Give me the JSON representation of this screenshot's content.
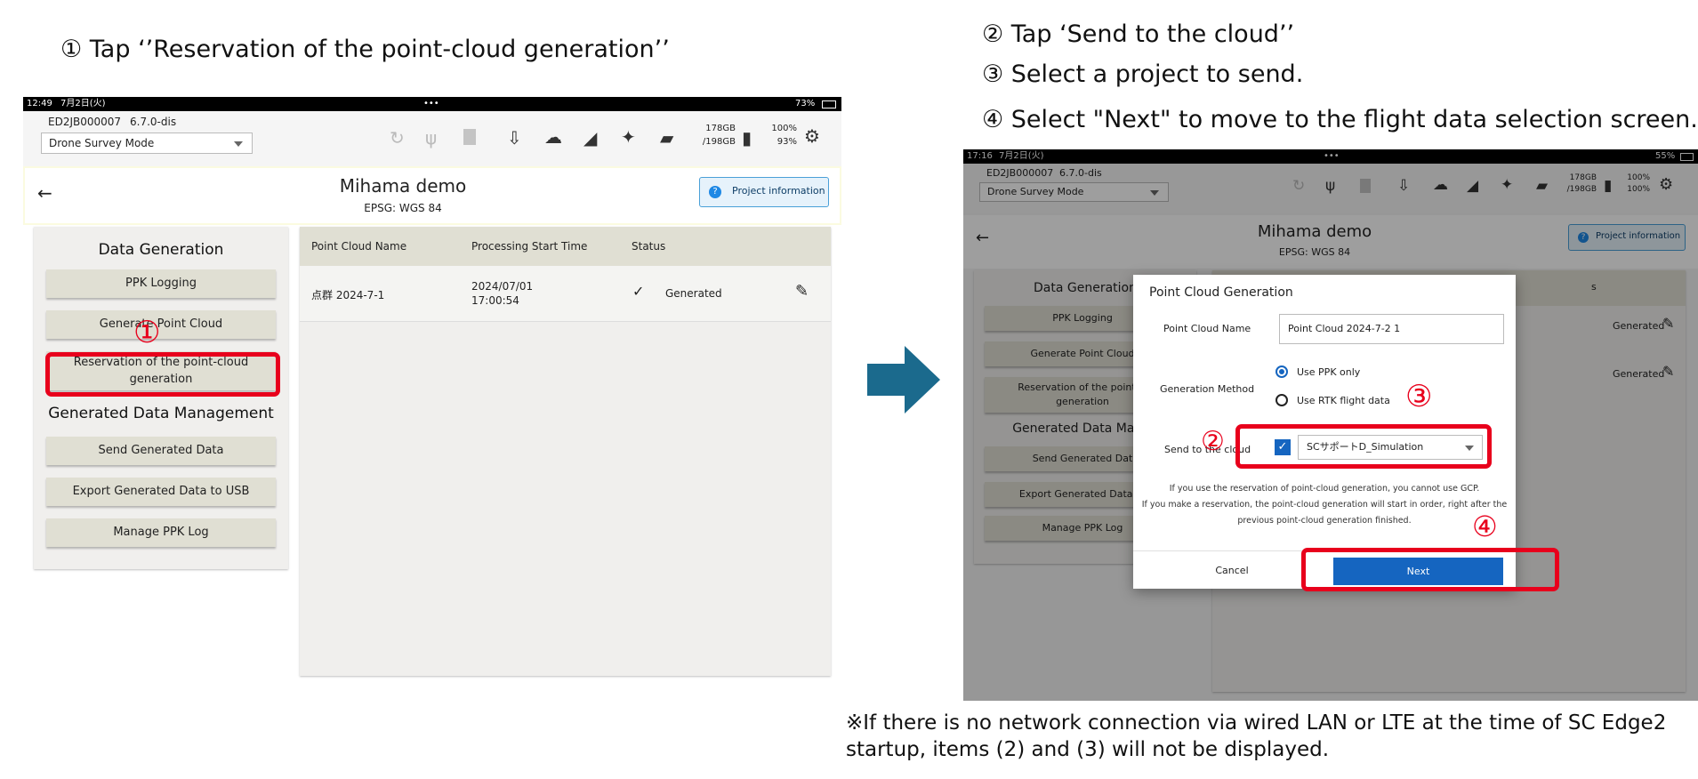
{
  "steps": {
    "step1": "① Tap ‘’Reservation of the point-cloud generation’’",
    "step2": "② Tap ‘Send to the cloud’’",
    "step3": "③ Select a project to send.",
    "step4": "④ Select \"Next\" to move to the flight data selection screen.",
    "note_line1": "※If there is no network connection via wired LAN or LTE at the time of SC Edge2",
    "note_line2": "startup, items (2) and (3) will not be displayed."
  },
  "markers": {
    "m1": "①",
    "m2": "②",
    "m3": "③",
    "m4": "④"
  },
  "left_screen": {
    "status": {
      "time": "12:49",
      "date": "7月2日(火)",
      "dots": "•••",
      "battery": "73%"
    },
    "device_id": "ED2JB000007",
    "version": "6.7.0-dis",
    "mode": "Drone Survey Mode",
    "storage": {
      "used": "178GB",
      "total": "/198GB"
    },
    "battery_pct": {
      "a": "100%",
      "b": "93%"
    },
    "project_name": "Mihama demo",
    "epsg": "EPSG: WGS 84",
    "project_info_label": "Project information",
    "data_generation_title": "Data Generation",
    "buttons": [
      "PPK Logging",
      "Generate Point Cloud",
      "Reservation of the point-cloud generation",
      "Send Generated Data",
      "Export Generated Data to USB",
      "Manage PPK Log"
    ],
    "generated_title": "Generated Data Management",
    "table": {
      "headers": [
        "Point Cloud Name",
        "Processing Start Time",
        "Status"
      ],
      "row": {
        "name": "点群 2024-7-1",
        "time_date": "2024/07/01",
        "time_clock": "17:00:54",
        "status": "Generated"
      }
    }
  },
  "right_screen": {
    "status": {
      "time": "17:16",
      "date": "7月2日(火)",
      "dots": "•••",
      "battery": "55%"
    },
    "device_id": "ED2JB000007",
    "version": "6.7.0-dis",
    "mode": "Drone Survey Mode",
    "storage": {
      "used": "178GB",
      "total": "/198GB"
    },
    "battery_pct": {
      "a": "100%",
      "b": "100%"
    },
    "project_name": "Mihama demo",
    "epsg": "EPSG: WGS 84",
    "project_info_label": "Project information",
    "data_generation_title": "Data Generation",
    "generated_title": "Generated Data Manag",
    "buttons": [
      "PPK Logging",
      "Generate Point Cloud",
      "Reservation of the point-cl",
      "generation",
      "Send Generated Dat",
      "Export Generated Data to",
      "Manage PPK Log"
    ],
    "bg_status": [
      "Generated",
      "Generated"
    ],
    "header_fragment": "s",
    "dialog": {
      "title": "Point Cloud Generation",
      "name_label": "Point Cloud Name",
      "name_value": "Point Cloud 2024-7-2 1",
      "method_label": "Generation Method",
      "option1": "Use PPK only",
      "option2": "Use RTK flight data",
      "send_label": "Send to the cloud",
      "project_value": "SCサポートD_Simulation",
      "info_line1": "If you use the reservation of point-cloud generation, you cannot use GCP.",
      "info_line2": "If you make a reservation, the point-cloud generation will start in order, right after the",
      "info_line3": "previous point-cloud generation finished.",
      "cancel": "Cancel",
      "next": "Next"
    }
  },
  "colors": {
    "red": "#e8001c",
    "arrow": "#1b6a8d",
    "primary": "#1565c0",
    "button": "#e0dfd3"
  }
}
